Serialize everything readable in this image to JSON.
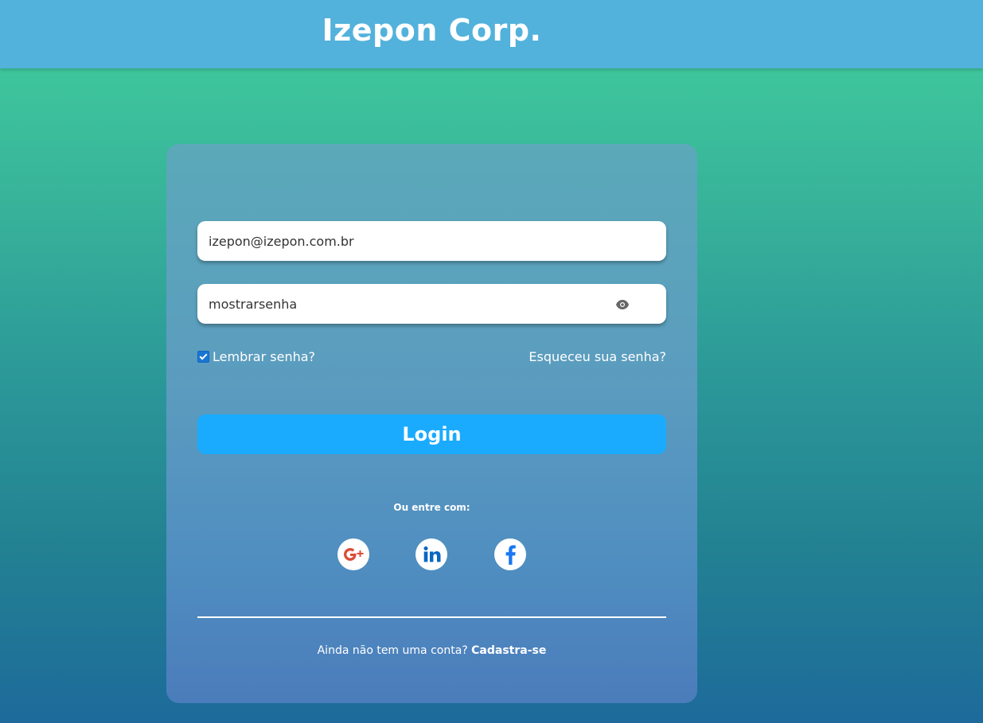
{
  "header": {
    "brand": "Izepon Corp."
  },
  "login": {
    "email_value": "izepon@izepon.com.br",
    "password_value": "mostrarsenha",
    "remember_label": "Lembrar senha?",
    "remember_checked": true,
    "forgot_label": "Esqueceu sua senha?",
    "login_button": "Login",
    "or_label": "Ou entre com:",
    "social": [
      "google-plus-icon",
      "linkedin-icon",
      "facebook-icon"
    ],
    "signup_prompt": "Ainda não tem uma conta?",
    "signup_link": "Cadastra-se"
  },
  "colors": {
    "header": "#52b2dc",
    "button": "#1aabff",
    "google": "#dd4b39",
    "linkedin": "#0a66c2",
    "facebook": "#1877f2"
  }
}
